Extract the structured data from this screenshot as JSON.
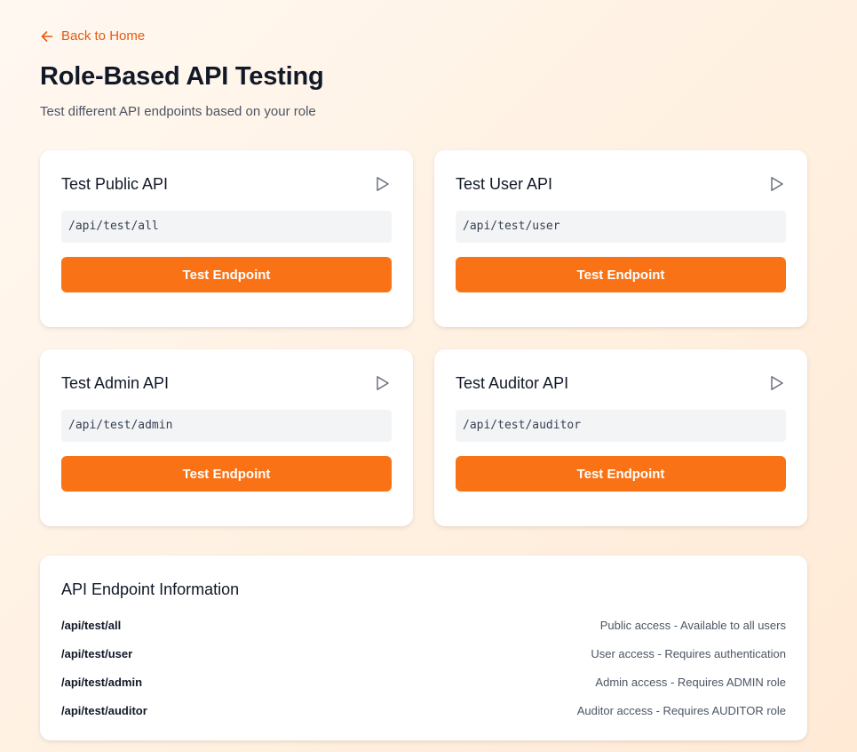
{
  "nav": {
    "back_label": "Back to Home"
  },
  "header": {
    "title": "Role-Based API Testing",
    "subtitle": "Test different API endpoints based on your role"
  },
  "cards": [
    {
      "title": "Test Public API",
      "endpoint": "/api/test/all",
      "button_label": "Test Endpoint"
    },
    {
      "title": "Test User API",
      "endpoint": "/api/test/user",
      "button_label": "Test Endpoint"
    },
    {
      "title": "Test Admin API",
      "endpoint": "/api/test/admin",
      "button_label": "Test Endpoint"
    },
    {
      "title": "Test Auditor API",
      "endpoint": "/api/test/auditor",
      "button_label": "Test Endpoint"
    }
  ],
  "info": {
    "title": "API Endpoint Information",
    "rows": [
      {
        "path": "/api/test/all",
        "description": "Public access - Available to all users"
      },
      {
        "path": "/api/test/user",
        "description": "User access - Requires authentication"
      },
      {
        "path": "/api/test/admin",
        "description": "Admin access - Requires ADMIN role"
      },
      {
        "path": "/api/test/auditor",
        "description": "Auditor access - Requires AUDITOR role"
      }
    ]
  },
  "colors": {
    "accent": "#f97316",
    "link": "#ea580c",
    "background": "#fff4e8",
    "card": "#ffffff"
  },
  "icons": {
    "back": "arrow-left-icon",
    "run": "play-icon"
  }
}
